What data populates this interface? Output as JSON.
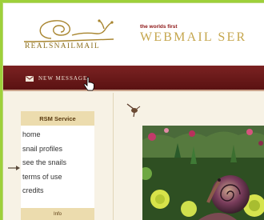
{
  "brand": {
    "logo_text": "REALSNAILMAIL",
    "tagline": "the worlds first",
    "title": "WEBMAIL SER"
  },
  "nav": {
    "new_message_label": "New message"
  },
  "sidebar": {
    "heading": "RSM Service",
    "items": [
      {
        "label": "home"
      },
      {
        "label": "snail profiles"
      },
      {
        "label": "see the snails"
      },
      {
        "label": "terms of use"
      },
      {
        "label": "credits"
      }
    ],
    "info_heading": "Info"
  },
  "colors": {
    "background_green": "#9ed03a",
    "nav_maroon": "#6a1a1a",
    "accent_gold": "#c5a64d",
    "tagline_red": "#8c1414",
    "panel_tan": "#ecdcae"
  }
}
